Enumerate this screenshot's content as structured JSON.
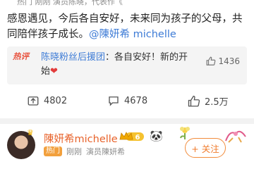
{
  "post1": {
    "meta_top": "热门  刚刚  演员陈晓，代表作《",
    "text_main": "感恩遇见，今后各自安好，未来同为孩子的父母，共同陪伴孩子成长。",
    "mention": "@陳妍希 michelle"
  },
  "hot_comment": {
    "tag": "热评",
    "author": "陈晓粉丝后援团",
    "text": "：各自安好！新的开始",
    "likes": "1436"
  },
  "actions": {
    "repost_count": "4802",
    "comment_count": "4678",
    "like_count": "2.5万"
  },
  "post2": {
    "username": "陳妍希michelle",
    "vip_level": "6",
    "hot_badge": "热门",
    "time": "刚刚",
    "source": "演员陳妍希",
    "follow_label": "+ 关注"
  },
  "colors": {
    "accent_orange": "#f07a2a",
    "link_blue": "#3d7bd6",
    "hot_badge": "#f2a03d",
    "heart_red": "#e23b3b"
  },
  "icons": [
    "repost-icon",
    "comment-icon",
    "like-icon",
    "heart-icon",
    "panda-icon",
    "vip-crown-icon"
  ]
}
